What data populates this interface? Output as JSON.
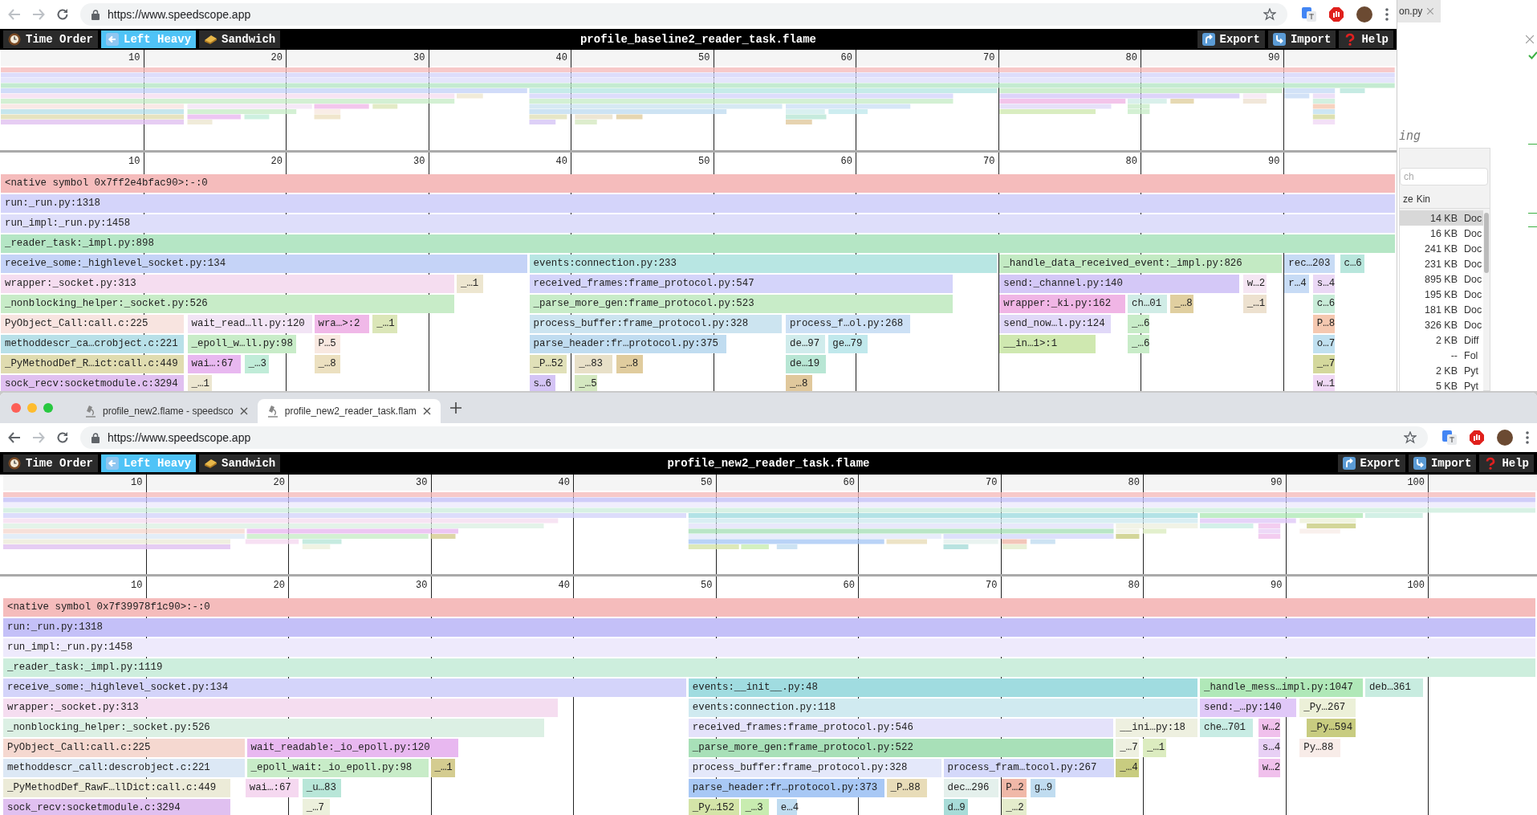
{
  "windows": [
    {
      "url": "https://www.speedscope.app",
      "back_enabled": false,
      "app": {
        "view_tabs": [
          {
            "kind": "clock",
            "label": "Time Order",
            "selected": false
          },
          {
            "kind": "left",
            "label": "Left Heavy",
            "selected": true
          },
          {
            "kind": "sandwich",
            "label": "Sandwich",
            "selected": false
          }
        ],
        "title": "profile_baseline2_reader_task.flame",
        "actions": [
          {
            "kind": "export",
            "label": "Export"
          },
          {
            "kind": "import",
            "label": "Import"
          },
          {
            "kind": "help",
            "label": "Help"
          }
        ],
        "minimap_ticks": [
          "10",
          "20",
          "30",
          "40",
          "50",
          "60",
          "70",
          "80",
          "90"
        ],
        "ticks": [
          "10",
          "20",
          "30",
          "40",
          "50",
          "60",
          "70",
          "80",
          "90"
        ],
        "rows": [
          {
            "frames": [
              {
                "label": "<native symbol 0x7ff2e4bfac90>:-:0",
                "color": "#f5bcbc"
              }
            ]
          },
          {
            "frames": [
              {
                "label": "run:_run.py:1318",
                "color": "#d4d4fa"
              }
            ]
          },
          {
            "frames": [
              {
                "label": "run_impl:_run.py:1458",
                "color": "#dedefa"
              }
            ]
          },
          {
            "frames": [
              {
                "label": "_reader_task:_impl.py:898",
                "color": "#b5e6c5"
              }
            ]
          },
          {
            "frames": [
              {
                "label": "receive_some:_highlevel_socket.py:134",
                "color": "#c5d3f7"
              },
              {
                "label": "events:connection.py:233",
                "color": "#b8e6e3"
              },
              {
                "label": "_handle_data_received_event:_impl.py:826",
                "color": "#c3eac3"
              },
              {
                "label": "rec…203",
                "color": "#c7dbf5"
              },
              {
                "label": "c…6",
                "color": "#b8e6dc"
              }
            ]
          },
          {
            "frames": [
              {
                "label": "wrapper:_socket.py:313",
                "color": "#f5ddf0"
              },
              {
                "label": "_…1",
                "color": "#ede6d0"
              },
              {
                "label": "received_frames:frame_protocol.py:547",
                "color": "#d4d4fa"
              },
              {
                "label": "send:_channel.py:140",
                "color": "#d4c8f7"
              },
              {
                "label": "w…2",
                "color": "#f5e6f3"
              },
              {
                "label": "r…4",
                "color": "#c7dbf5"
              },
              {
                "label": "s…4",
                "color": "#ead8f5"
              }
            ]
          },
          {
            "frames": [
              {
                "label": "_nonblocking_helper:_socket.py:526",
                "color": "#c8ecc8"
              },
              {
                "label": "_parse_more_gen:frame_protocol.py:523",
                "color": "#c8ecc8"
              },
              {
                "label": "wrapper:_ki.py:162",
                "color": "#f0b5e5"
              },
              {
                "label": "ch…01",
                "color": "#d0ece6"
              },
              {
                "label": "_…8",
                "color": "#e0cfa0"
              },
              {
                "label": "_…1",
                "color": "#ede1cf"
              },
              {
                "label": "c…6",
                "color": "#c8ecd8"
              }
            ]
          },
          {
            "frames": [
              {
                "label": "PyObject_Call:call.c:225",
                "color": "#f8e4e0"
              },
              {
                "label": "wait_read…ll.py:120",
                "color": "#f2e4f5"
              },
              {
                "label": "wra…>:2",
                "color": "#f0b8e8"
              },
              {
                "label": "_…1",
                "color": "#dbe6b8"
              },
              {
                "label": "process_buffer:frame_protocol.py:328",
                "color": "#cce4f0"
              },
              {
                "label": "process_f…ol.py:268",
                "color": "#cce0f5"
              },
              {
                "label": "send_now…l.py:124",
                "color": "#e0d8f8"
              },
              {
                "label": "_…6",
                "color": "#c8ecc8"
              },
              {
                "label": "P…8",
                "color": "#f5c8b0"
              }
            ]
          },
          {
            "frames": [
              {
                "label": "methoddescr_ca…crobject.c:221",
                "color": "#b8e0e8"
              },
              {
                "label": "_epoll_w…ll.py:98",
                "color": "#c8ecc8"
              },
              {
                "label": "P…5",
                "color": "#f8e8e0"
              },
              {
                "label": "parse_header:fr…protocol.py:375",
                "color": "#c0dcf0"
              },
              {
                "label": "de…97",
                "color": "#d0ecec"
              },
              {
                "label": "ge…79",
                "color": "#c0e8ec"
              },
              {
                "label": "__in…1>:1",
                "color": "#cfe8b0"
              },
              {
                "label": "_…6",
                "color": "#c8ecc8"
              },
              {
                "label": "o…7",
                "color": "#c0e0f0"
              }
            ]
          },
          {
            "frames": [
              {
                "label": "_PyMethodDef_R…ict:call.c:449",
                "color": "#e0dcb0"
              },
              {
                "label": "wai…:67",
                "color": "#e8b8f0"
              },
              {
                "label": "_…3",
                "color": "#c0ecd8"
              },
              {
                "label": "_…8",
                "color": "#ece0c0"
              },
              {
                "label": "_P…52",
                "color": "#e0e0b8"
              },
              {
                "label": "_…83",
                "color": "#e8e0c8"
              },
              {
                "label": "_…8",
                "color": "#e0cc9e"
              },
              {
                "label": "de…19",
                "color": "#b8e6d4"
              },
              {
                "label": "_…7",
                "color": "#d4d89c"
              }
            ]
          },
          {
            "frames": [
              {
                "label": "sock_recv:socketmodule.c:3294",
                "color": "#e0c0f0"
              },
              {
                "label": "_…1",
                "color": "#ece6d0"
              },
              {
                "label": "s…6",
                "color": "#d4c4f5"
              },
              {
                "label": "_…5",
                "color": "#d4e8c0"
              },
              {
                "label": "_…8",
                "color": "#e0c89c"
              },
              {
                "label": "w…1",
                "color": "#f0d8f5"
              }
            ]
          }
        ]
      }
    },
    {
      "tabs": [
        {
          "label": "profile_new2.flame - speedsco",
          "selected": false
        },
        {
          "label": "profile_new2_reader_task.flam",
          "selected": true
        }
      ],
      "url": "https://www.speedscope.app",
      "back_enabled": true,
      "app": {
        "view_tabs": [
          {
            "kind": "clock",
            "label": "Time Order",
            "selected": false
          },
          {
            "kind": "left",
            "label": "Left Heavy",
            "selected": true
          },
          {
            "kind": "sandwich",
            "label": "Sandwich",
            "selected": false
          }
        ],
        "title": "profile_new2_reader_task.flame",
        "actions": [
          {
            "kind": "export",
            "label": "Export"
          },
          {
            "kind": "import",
            "label": "Import"
          },
          {
            "kind": "help",
            "label": "Help"
          }
        ],
        "minimap_ticks": [
          "10",
          "20",
          "30",
          "40",
          "50",
          "60",
          "70",
          "80",
          "90",
          "100"
        ],
        "ticks": [
          "10",
          "20",
          "30",
          "40",
          "50",
          "60",
          "70",
          "80",
          "90",
          "100"
        ],
        "rows": [
          {
            "frames": [
              {
                "label": "<native symbol 0x7f39978f1c90>:-:0",
                "color": "#f5bcbc"
              }
            ]
          },
          {
            "frames": [
              {
                "label": "run:_run.py:1318",
                "color": "#c4c0f8"
              }
            ]
          },
          {
            "frames": [
              {
                "label": "run_impl:_run.py:1458",
                "color": "#eeeafc"
              }
            ]
          },
          {
            "frames": [
              {
                "label": "_reader_task:_impl.py:1119",
                "color": "#cdeedd"
              }
            ]
          },
          {
            "frames": [
              {
                "label": "receive_some:_highlevel_socket.py:134",
                "color": "#d4d4fa"
              },
              {
                "label": "events:__init__.py:48",
                "color": "#a0dce0"
              },
              {
                "label": "_handle_mess…impl.py:1047",
                "color": "#b0e8b8"
              },
              {
                "label": "deb…361",
                "color": "#c8ece0"
              }
            ]
          },
          {
            "frames": [
              {
                "label": "wrapper:_socket.py:313",
                "color": "#f5ddf0"
              },
              {
                "label": "events:connection.py:118",
                "color": "#d0eaf0"
              },
              {
                "label": "send:_…py:140",
                "color": "#e0c8f8"
              },
              {
                "label": "_Py…267",
                "color": "#ecf0d8"
              }
            ]
          },
          {
            "frames": [
              {
                "label": "_nonblocking_helper:_socket.py:526",
                "color": "#dcf0e4"
              },
              {
                "label": "received_frames:frame_protocol.py:546",
                "color": "#e4e2fa"
              },
              {
                "label": "__ini…py:18",
                "color": "#eef0e0"
              },
              {
                "label": "che…701",
                "color": "#c8ece4"
              },
              {
                "label": "w…2",
                "color": "#f0c0ec"
              },
              {
                "label": "_Py…594",
                "color": "#c8cc80"
              }
            ]
          },
          {
            "frames": [
              {
                "label": "PyObject_Call:call.c:225",
                "color": "#f5d8d0"
              },
              {
                "label": "wait_readable:_io_epoll.py:120",
                "color": "#e8b8f0"
              },
              {
                "label": "_parse_more_gen:frame_protocol.py:522",
                "color": "#a8e0b8"
              },
              {
                "label": "_…7",
                "color": "#eef0e0"
              },
              {
                "label": "_…1",
                "color": "#dcecc0"
              },
              {
                "label": "s…4",
                "color": "#e8d0f5"
              },
              {
                "label": "Py…88",
                "color": "#f8ece8"
              }
            ]
          },
          {
            "frames": [
              {
                "label": "methoddescr_call:descrobject.c:221",
                "color": "#dce8f5"
              },
              {
                "label": "_epoll_wait:_io_epoll.py:98",
                "color": "#c8ecc8"
              },
              {
                "label": "_…1",
                "color": "#d4cc90"
              },
              {
                "label": "process_buffer:frame_protocol.py:328",
                "color": "#e4e8fa"
              },
              {
                "label": "process_fram…tocol.py:267",
                "color": "#d4d8fa"
              },
              {
                "label": "_…4",
                "color": "#c8cc80"
              },
              {
                "label": "w…2",
                "color": "#f0c0ec"
              }
            ]
          },
          {
            "frames": [
              {
                "label": "_PyMethodDef_RawF…llDict:call.c:449",
                "color": "#ecebd8"
              },
              {
                "label": "wai…:67",
                "color": "#f5d8f0"
              },
              {
                "label": "_u…83",
                "color": "#b8e6d8"
              },
              {
                "label": "parse_header:fr…protocol.py:373",
                "color": "#a8c8f5"
              },
              {
                "label": "_P…88",
                "color": "#e8dcb8"
              },
              {
                "label": "dec…296",
                "color": "#e4f0ec"
              },
              {
                "label": "P…2",
                "color": "#f0b8a8"
              },
              {
                "label": "g…9",
                "color": "#c0dcf0"
              }
            ]
          },
          {
            "frames": [
              {
                "label": "sock_recv:socketmodule.c:3294",
                "color": "#e0c0f0"
              },
              {
                "label": "_…7",
                "color": "#ecf0dc"
              },
              {
                "label": "_Py…152",
                "color": "#d4e4a8"
              },
              {
                "label": "_…3",
                "color": "#c8ecb0"
              },
              {
                "label": "e…4",
                "color": "#c0dcf0"
              },
              {
                "label": "d…9",
                "color": "#a8dcd8"
              },
              {
                "label": "_…2",
                "color": "#e4eccc"
              }
            ]
          }
        ]
      }
    }
  ],
  "side_window": {
    "tab": "on.py",
    "heading": "ing",
    "search": {
      "placeholder": "ch"
    },
    "columns": [
      "ze",
      "Kin"
    ],
    "rows": [
      {
        "size": "14 KB",
        "type": "Doc",
        "selected": true
      },
      {
        "size": "16 KB",
        "type": "Doc",
        "selected": false
      },
      {
        "size": "241 KB",
        "type": "Doc",
        "selected": false
      },
      {
        "size": "231 KB",
        "type": "Doc",
        "selected": false
      },
      {
        "size": "895 KB",
        "type": "Doc",
        "selected": false
      },
      {
        "size": "195 KB",
        "type": "Doc",
        "selected": false
      },
      {
        "size": "181 KB",
        "type": "Doc",
        "selected": false
      },
      {
        "size": "326 KB",
        "type": "Doc",
        "selected": false
      },
      {
        "size": "2 KB",
        "type": "Diff",
        "selected": false
      },
      {
        "size": "--",
        "type": "Fol",
        "selected": false
      },
      {
        "size": "2 KB",
        "type": "Pyt",
        "selected": false
      },
      {
        "size": "5 KB",
        "type": "Pyt",
        "selected": false
      }
    ]
  }
}
